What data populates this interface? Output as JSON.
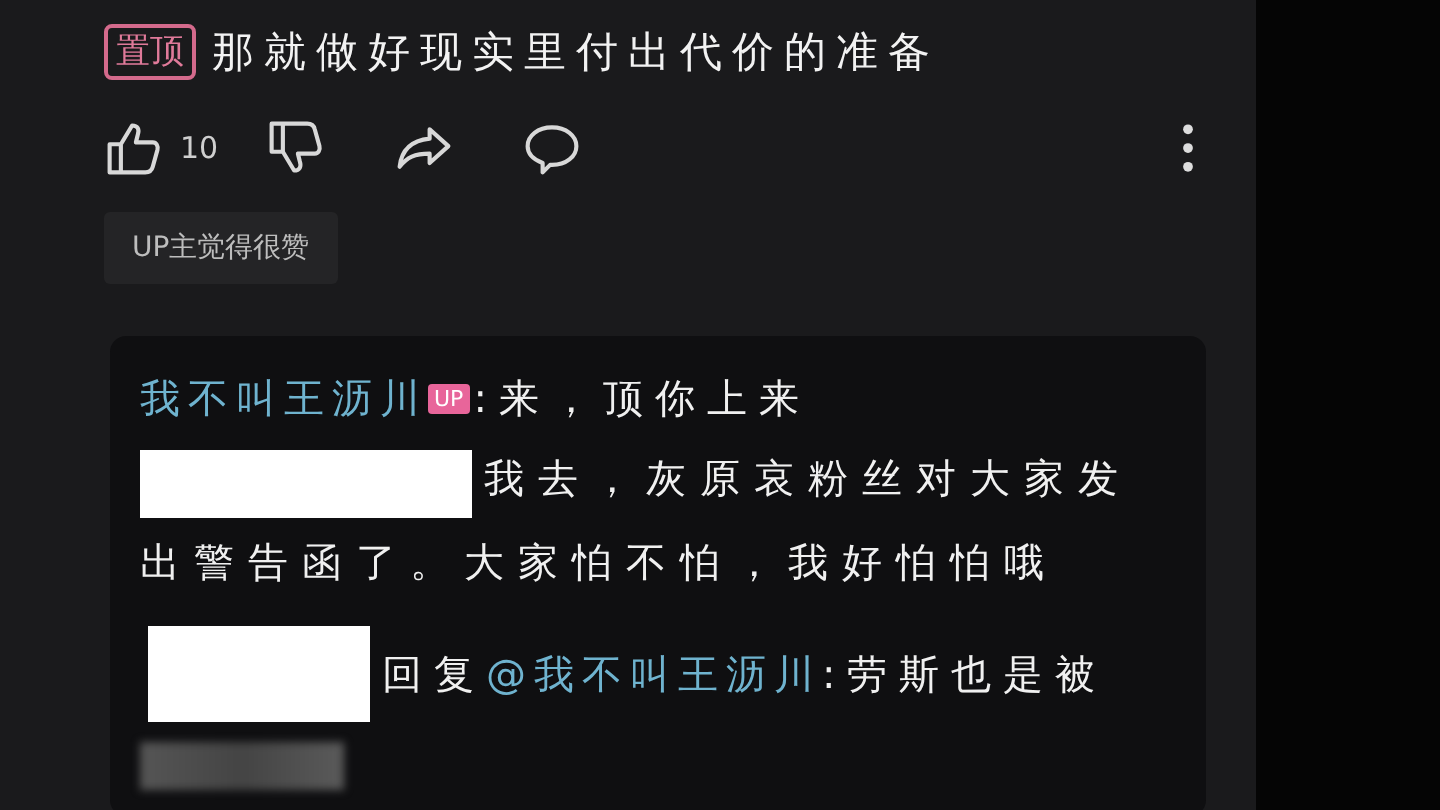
{
  "pinned_comment": {
    "badge": "置顶",
    "text": "那就做好现实里付出代价的准备",
    "likes": "10",
    "up_liked_label": "UP主觉得很赞"
  },
  "replies": [
    {
      "author_hidden": false,
      "author": "我不叫王沥川",
      "author_badge": "UP",
      "text": ":来，顶你上来"
    },
    {
      "author_hidden": true,
      "text": "我去，灰原哀粉丝对大家发出警告函了。大家怕不怕，我好怕怕哦"
    },
    {
      "author_hidden": true,
      "reply_prefix": "回复",
      "mention": "@我不叫王沥川",
      "text": ":劳斯也是被",
      "blurred_tail": true
    }
  ]
}
